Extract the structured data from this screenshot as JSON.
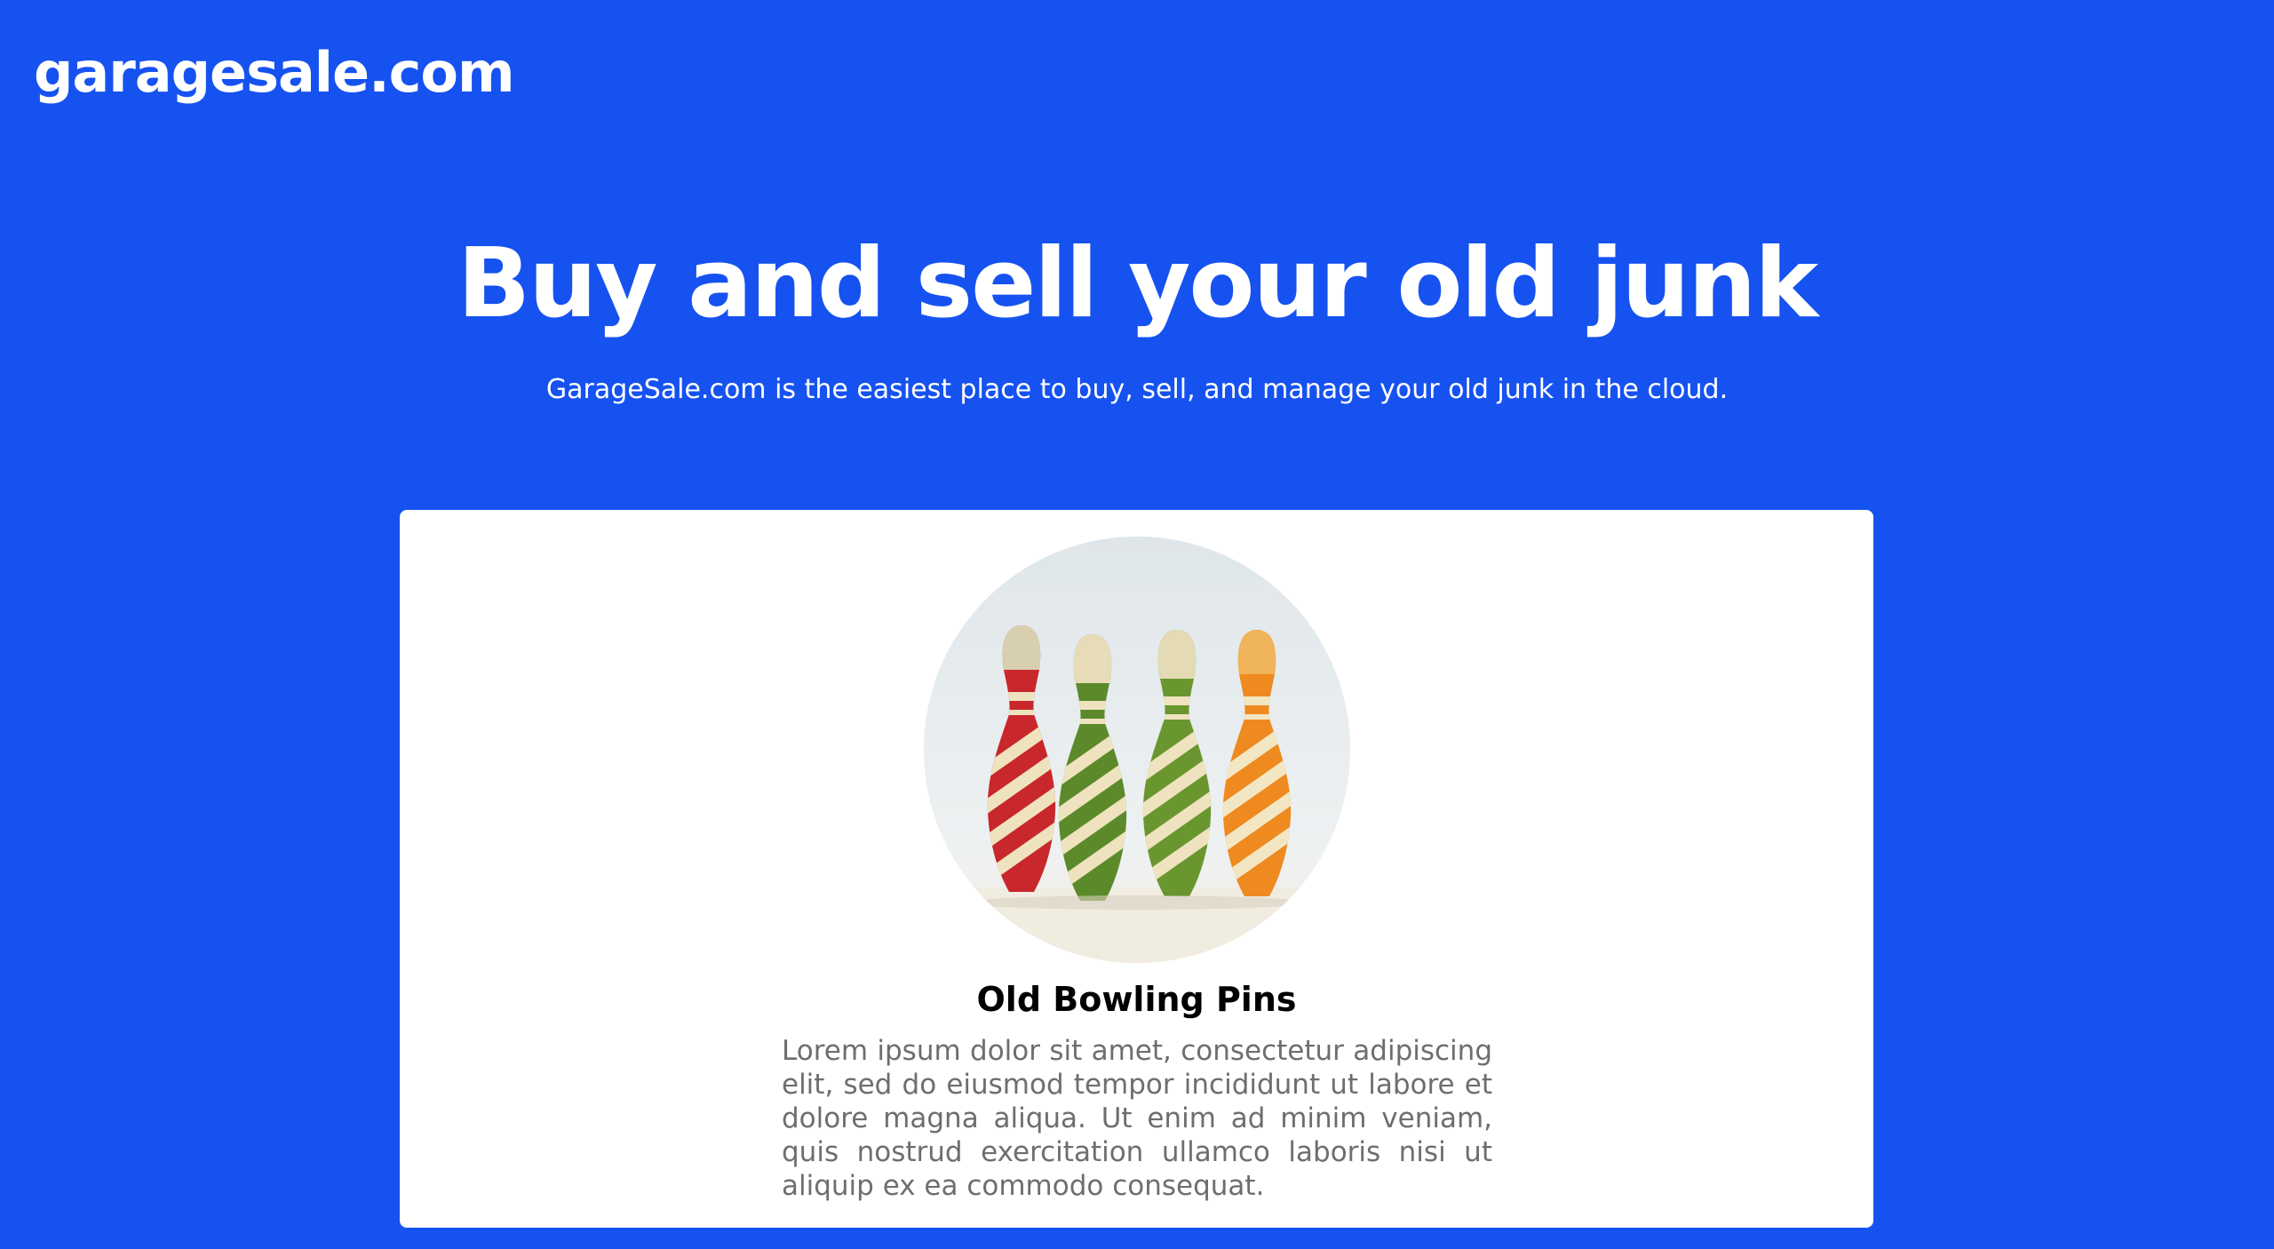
{
  "header": {
    "logo_text": "garagesale.com"
  },
  "hero": {
    "title": "Buy and sell your old junk",
    "subtitle": "GarageSale.com is the easiest place to buy, sell, and manage your old junk in the cloud."
  },
  "product": {
    "image_alt": "bowling-pins-photo",
    "name": "Old Bowling Pins",
    "description": "Lorem ipsum dolor sit amet, consectetur adipiscing elit, sed do eiusmod tempor incididunt ut labore et dolore magna aliqua. Ut enim ad minim veniam, quis nostrud exercitation ullamco laboris nisi ut aliquip ex ea commodo consequat."
  },
  "colors": {
    "background": "#1652f0",
    "card": "#ffffff",
    "title_text": "#ffffff",
    "product_name": "#000000",
    "description_text": "#6e6e6e"
  }
}
